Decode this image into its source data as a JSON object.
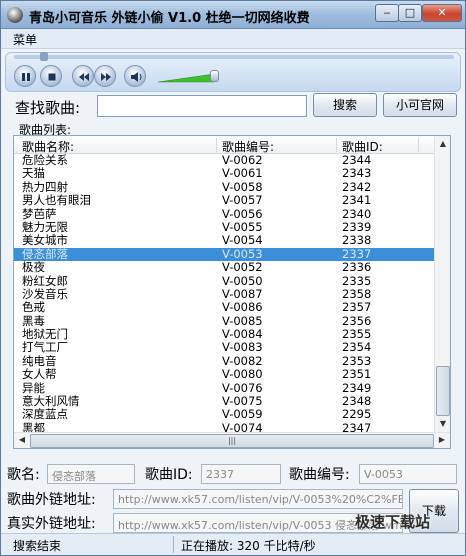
{
  "window": {
    "title": "青岛小可音乐 外链小偷 V1.0 杜绝一切网络收费",
    "minimize_glyph": "‒",
    "maximize_glyph": "□",
    "close_glyph": "✕"
  },
  "menu": {
    "label": "菜单"
  },
  "player": {
    "icons": [
      "pause-icon",
      "stop-icon",
      "previous-icon",
      "next-icon",
      "volume-icon"
    ]
  },
  "search": {
    "label": "查找歌曲:",
    "value": "",
    "button": "搜索",
    "website_button": "小可官网"
  },
  "list": {
    "caption": "歌曲列表:",
    "columns": [
      "歌曲名称:",
      "歌曲编号:",
      "歌曲ID:"
    ],
    "rows": [
      [
        "危险关系",
        "V-0062",
        "2344"
      ],
      [
        "天猫",
        "V-0061",
        "2343"
      ],
      [
        "热力四射",
        "V-0058",
        "2342"
      ],
      [
        "男人也有眼泪",
        "V-0057",
        "2341"
      ],
      [
        "梦芭萨",
        "V-0056",
        "2340"
      ],
      [
        "魅力无限",
        "V-0055",
        "2339"
      ],
      [
        "美女城市",
        "V-0054",
        "2338"
      ],
      [
        "侵忞部落",
        "V-0053",
        "2337"
      ],
      [
        "极夜",
        "V-0052",
        "2336"
      ],
      [
        "粉红女郎",
        "V-0050",
        "2335"
      ],
      [
        "沙发音乐",
        "V-0087",
        "2358"
      ],
      [
        "色戒",
        "V-0086",
        "2357"
      ],
      [
        "黑毒",
        "V-0085",
        "2356"
      ],
      [
        "地狱无门",
        "V-0084",
        "2355"
      ],
      [
        "打气工厂",
        "V-0083",
        "2354"
      ],
      [
        "纯电音",
        "V-0082",
        "2353"
      ],
      [
        "女人帮",
        "V-0080",
        "2351"
      ],
      [
        "异能",
        "V-0076",
        "2349"
      ],
      [
        "意大利风情",
        "V-0075",
        "2348"
      ],
      [
        "深度蓝点",
        "V-0059",
        "2295"
      ],
      [
        "黑都",
        "V-0074",
        "2347"
      ]
    ],
    "selected_row": 7,
    "scroll_thumb_glyph": "|||"
  },
  "details": {
    "name_label": "歌名:",
    "name_value": "侵忞部落",
    "id_label": "歌曲ID:",
    "id_value": "2337",
    "code_label": "歌曲编号:",
    "code_value": "V-0053",
    "ext_link_label": "歌曲外链地址:",
    "ext_link_value": "http://www.xk57.com/listen/vip/V-0053%20%C2%FE%E",
    "real_link_label": "真实外链地址:",
    "real_link_value": "http://www.xk57.com/listen/vip/V-0053 侵忞部落.wma",
    "download_button": "下载"
  },
  "status": {
    "left": "搜索结束",
    "right": "正在播放: 320 千比特/秒"
  },
  "watermark": "极速下载站",
  "colors": {
    "selected_row": "#3a8fd8",
    "titlebar": "#9dbbdc",
    "volume_green": "#3fbf2f"
  }
}
